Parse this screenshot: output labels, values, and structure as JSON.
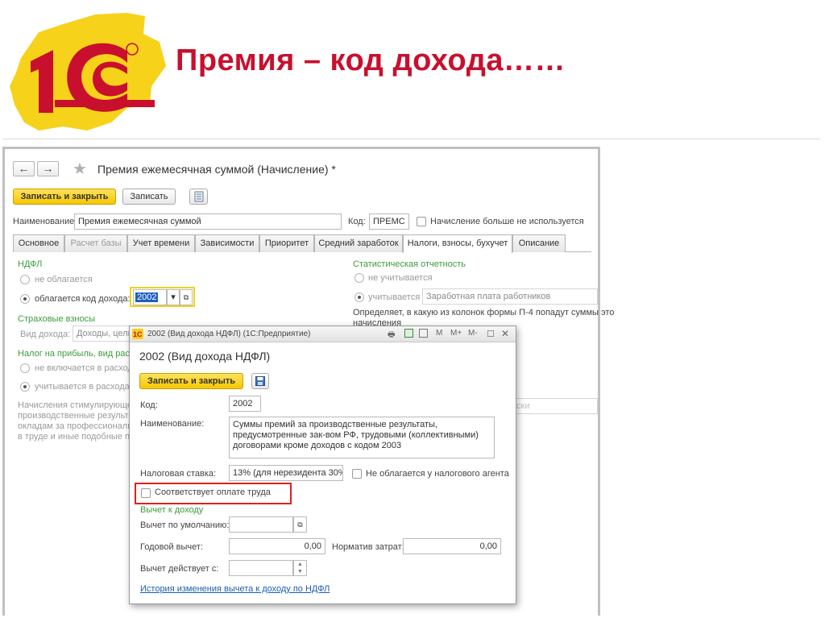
{
  "slide": {
    "title": "Премия – код дохода……",
    "logo_text": "1С",
    "logo_reg": "®"
  },
  "main_window": {
    "title": "Премия ежемесячная суммой (Начисление) *",
    "nav": {
      "back": "←",
      "forward": "→"
    },
    "toolbar": {
      "save_close": "Записать и закрыть",
      "save": "Записать"
    },
    "name_label": "Наименование:",
    "name_value": "Премия ежемесячная суммой",
    "code_label": "Код:",
    "code_value": "ПРЕМС",
    "not_used_label": "Начисление больше не используется",
    "tabs": [
      {
        "label": "Основное"
      },
      {
        "label": "Расчет базы"
      },
      {
        "label": "Учет времени"
      },
      {
        "label": "Зависимости"
      },
      {
        "label": "Приоритет"
      },
      {
        "label": "Средний заработок"
      },
      {
        "label": "Налоги, взносы, бухучет"
      },
      {
        "label": "Описание"
      }
    ],
    "ndfl": {
      "header": "НДФЛ",
      "not_taxed": "не облагается",
      "taxed": "облагается",
      "income_code_label": "код дохода:",
      "income_code_value": "2002"
    },
    "insurance": {
      "header": "Страховые взносы",
      "income_type_label": "Вид дохода:",
      "income_type_value": "Доходы, цели"
    },
    "profit_tax": {
      "header": "Налог на прибыль, вид расх",
      "not_included": "не включается в расход",
      "included": "учитывается в расходах"
    },
    "description_lines": [
      "Начисления стимулирующе",
      "производственные результа",
      "окладам за профессиональ",
      "в труде и иные подобные по"
    ],
    "stats": {
      "header": "Статистическая отчетность",
      "not_counted": "не учитывается",
      "counted": "учитывается",
      "counted_value": "Заработная плата работников",
      "note_line1": "Определяет, в какую из колонок формы П-4 попадут суммы это",
      "note_line2": "начисления",
      "faded_text": "ски"
    }
  },
  "dialog": {
    "window_title": "2002 (Вид дохода НДФЛ)  (1С:Предприятие)",
    "toolbar_icons": {
      "m": "M",
      "m_plus": "M+",
      "m_minus": "M-"
    },
    "header": "2002 (Вид дохода НДФЛ)",
    "save_close": "Записать и закрыть",
    "code_label": "Код:",
    "code_value": "2002",
    "name_label": "Наименование:",
    "name_lines": [
      "Суммы премий за производственные результаты,",
      "предусмотренные зак-вом РФ, трудовыми (коллективными)",
      "договорами кроме доходов с кодом 2003"
    ],
    "tax_rate_label": "Налоговая ставка:",
    "tax_rate_value": "13% (для нерезидента 30%)",
    "not_taxed_agent": "Не облагается у налогового агента",
    "labor_payment": "Соответствует оплате труда",
    "deduction_header": "Вычет к доходу",
    "default_deduction_label": "Вычет по умолчанию:",
    "annual_deduction_label": "Годовой вычет:",
    "annual_deduction_value": "0,00",
    "cost_norm_label": "Норматив затрат:",
    "cost_norm_value": "0,00",
    "valid_from_label": "Вычет действует с:",
    "history_link": "История изменения вычета к доходу по НДФЛ"
  },
  "colors": {
    "title_red": "#c8102e",
    "logo_yellow": "#f6d21a",
    "button_yellow": "#f6c700",
    "section_green": "#3c9b3c",
    "link_blue": "#1a5fb4",
    "highlight_red": "#e02020"
  }
}
